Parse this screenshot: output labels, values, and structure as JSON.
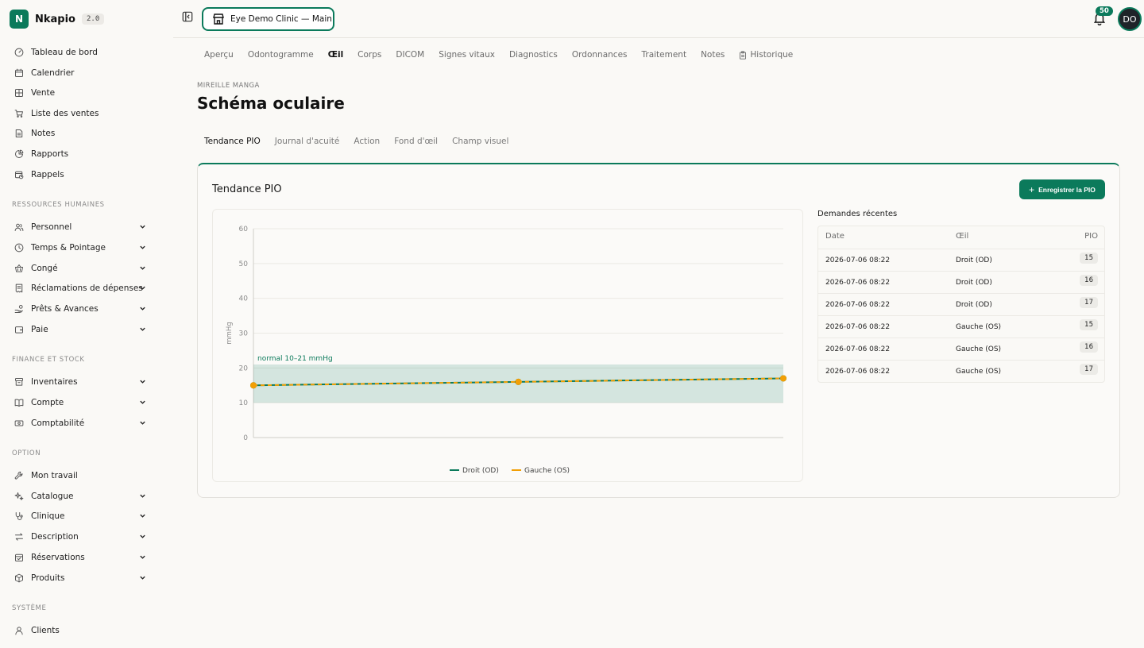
{
  "app": {
    "name": "Nkapio",
    "version": "2.0",
    "logo_letter": "N"
  },
  "topbar": {
    "clinic": "Eye Demo Clinic — Main",
    "notifications": "50",
    "avatar": "DO"
  },
  "sidebar": {
    "items_top": [
      {
        "label": "Tableau de bord",
        "icon": "dashboard-icon"
      },
      {
        "label": "Calendrier",
        "icon": "calendar-icon"
      },
      {
        "label": "Vente",
        "icon": "grid-icon"
      },
      {
        "label": "Liste des ventes",
        "icon": "cart-icon"
      },
      {
        "label": "Notes",
        "icon": "note-icon"
      },
      {
        "label": "Rapports",
        "icon": "pie-icon"
      },
      {
        "label": "Rappels",
        "icon": "calendar-clock-icon"
      }
    ],
    "section_hr": "RESSOURCES HUMAINES",
    "items_hr": [
      {
        "label": "Personnel",
        "icon": "users-icon"
      },
      {
        "label": "Temps & Pointage",
        "icon": "clock-icon"
      },
      {
        "label": "Congé",
        "icon": "basket-icon"
      },
      {
        "label": "Réclamations de dépenses",
        "icon": "receipt-icon"
      },
      {
        "label": "Prêts & Avances",
        "icon": "hand-coins-icon"
      },
      {
        "label": "Paie",
        "icon": "wallet-icon"
      }
    ],
    "section_fin": "FINANCE ET STOCK",
    "items_fin": [
      {
        "label": "Inventaires",
        "icon": "inventory-icon"
      },
      {
        "label": "Compte",
        "icon": "book-icon"
      },
      {
        "label": "Comptabilité",
        "icon": "money-icon"
      }
    ],
    "section_opt": "OPTION",
    "items_opt": [
      {
        "label": "Mon travail",
        "icon": "wrench-icon",
        "chevron": false
      },
      {
        "label": "Catalogue",
        "icon": "sparkles-icon",
        "chevron": true
      },
      {
        "label": "Clinique",
        "icon": "stethoscope-icon",
        "chevron": true
      },
      {
        "label": "Description",
        "icon": "arrows-icon",
        "chevron": true
      },
      {
        "label": "Réservations",
        "icon": "calendar-check-icon",
        "chevron": true
      },
      {
        "label": "Produits",
        "icon": "package-icon",
        "chevron": true
      }
    ],
    "section_sys": "SYSTÈME",
    "items_sys": [
      {
        "label": "Clients",
        "icon": "user-icon"
      }
    ]
  },
  "main_tabs": [
    "Aperçu",
    "Odontogramme",
    "Œil",
    "Corps",
    "DICOM",
    "Signes vitaux",
    "Diagnostics",
    "Ordonnances",
    "Traitement",
    "Notes",
    "Historique"
  ],
  "patient_name": "MIREILLE MANGA",
  "page_title": "Schéma oculaire",
  "sub_tabs": [
    "Tendance PIO",
    "Journal d'acuité",
    "Action",
    "Fond d'œil",
    "Champ visuel"
  ],
  "card": {
    "title": "Tendance PIO",
    "record_button": "Enregistrer la PIO"
  },
  "chart_data": {
    "type": "line",
    "ylabel": "mmHg",
    "ylim": [
      0,
      60
    ],
    "yticks": [
      0,
      10,
      20,
      30,
      40,
      50,
      60
    ],
    "band": {
      "from": 10,
      "to": 21,
      "label": "normal 10–21 mmHg"
    },
    "series": [
      {
        "name": "Droit (OD)",
        "color": "#0b7a5b",
        "values": [
          15,
          16,
          17
        ]
      },
      {
        "name": "Gauche (OS)",
        "color": "#f29f05",
        "values": [
          15,
          16,
          17
        ]
      }
    ]
  },
  "recent": {
    "title": "Demandes récentes",
    "columns": [
      "Date",
      "Œil",
      "PIO"
    ],
    "rows": [
      {
        "date": "2026-07-06 08:22",
        "eye": "Droit (OD)",
        "pio": "15"
      },
      {
        "date": "2026-07-06 08:22",
        "eye": "Droit (OD)",
        "pio": "16"
      },
      {
        "date": "2026-07-06 08:22",
        "eye": "Droit (OD)",
        "pio": "17"
      },
      {
        "date": "2026-07-06 08:22",
        "eye": "Gauche (OS)",
        "pio": "15"
      },
      {
        "date": "2026-07-06 08:22",
        "eye": "Gauche (OS)",
        "pio": "16"
      },
      {
        "date": "2026-07-06 08:22",
        "eye": "Gauche (OS)",
        "pio": "17"
      }
    ]
  }
}
